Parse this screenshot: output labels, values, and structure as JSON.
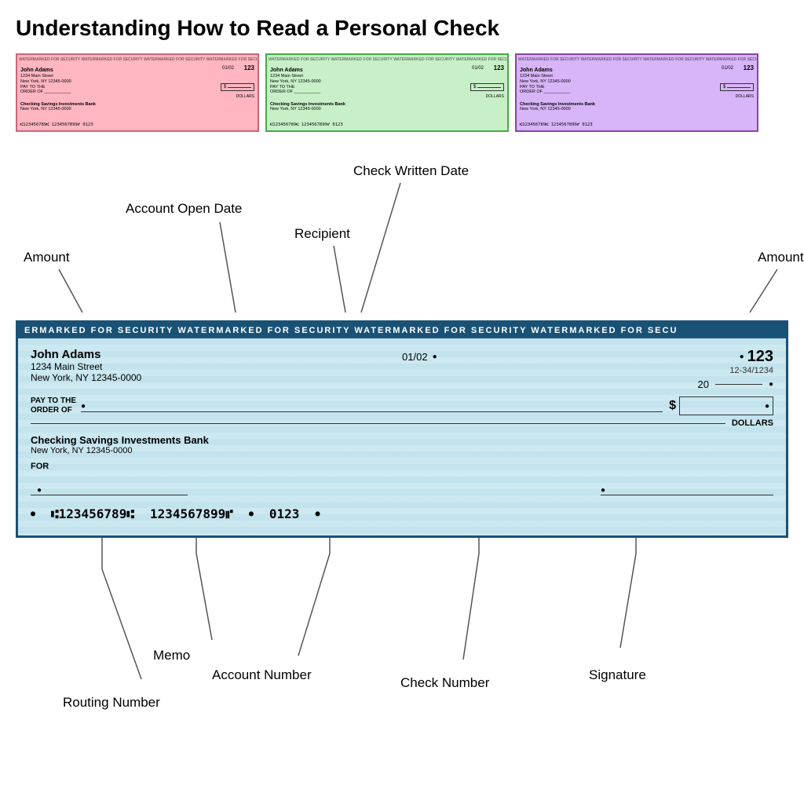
{
  "title": "Understanding How to Read a Personal Check",
  "miniChecks": [
    {
      "id": "pink",
      "colorClass": "mini-check-pink",
      "name": "John Adams",
      "address1": "1234 Main Street",
      "address2": "New York, NY 12345-0000",
      "date": "01/02",
      "number": "123",
      "watermark": "WATERMARKED FOR SECURITY   WATERMARKED FOR SECURITY   WATERMARKED FOR SECURITY   WATERMARKED FOR SECU",
      "micr": "⑆123456789⑆  1234567899⑈  0123"
    },
    {
      "id": "green",
      "colorClass": "mini-check-green",
      "name": "John Adams",
      "address1": "1234 Main Street",
      "address2": "New York, NY 12345-0000",
      "date": "01/02",
      "number": "123",
      "watermark": "WATERMARKED FOR SECURITY   WATERMARKED FOR SECURITY   WATERMARKED FOR SECURITY   WATERMARKED FOR SECU",
      "micr": "⑆123456789⑆  1234567899⑈  0123"
    },
    {
      "id": "purple",
      "colorClass": "mini-check-purple",
      "name": "John Adams",
      "address1": "1234 Main Street",
      "address2": "New York, NY 12345-0000",
      "date": "01/02",
      "number": "123",
      "watermark": "WATERMARKED FOR SECURITY   WATERMARKED FOR SECURITY   WATERMARKED FOR SECURITY   WATERMARKED FOR SECU",
      "micr": "⑆123456789⑆  1234567899⑈  0123"
    }
  ],
  "annotations": {
    "checkWrittenDate": "Check Written Date",
    "accountOpenDate": "Account Open Date",
    "recipient": "Recipient",
    "amountLeft": "Amount",
    "amountRight": "Amount",
    "memo": "Memo",
    "accountNumber": "Account Number",
    "routingNumber": "Routing Number",
    "checkNumber": "Check Number",
    "signature": "Signature"
  },
  "check": {
    "watermark": "ERMARKED FOR SECURITY     WATERMARKED FOR SECURITY     WATERMARKED FOR SECURITY     WATERMARKED FOR SECU",
    "name": "John Adams",
    "address1": "1234 Main Street",
    "address2": "New York, NY 12345-0000",
    "date": "01/02",
    "checkNumber": "123",
    "fracNumber": "12-34/1234",
    "dateYear": "20",
    "payToLabel": "PAY TO THE\nORDER OF",
    "dollarSign": "$",
    "dollarsLabel": "DOLLARS",
    "bankName": "Checking Savings Investments Bank",
    "bankAddress": "New York, NY 12345-0000",
    "forLabel": "FOR",
    "micrRouting": "⑆123456789⑆",
    "micrAccount": "1234567899⑈",
    "micrCheck": "0123"
  }
}
